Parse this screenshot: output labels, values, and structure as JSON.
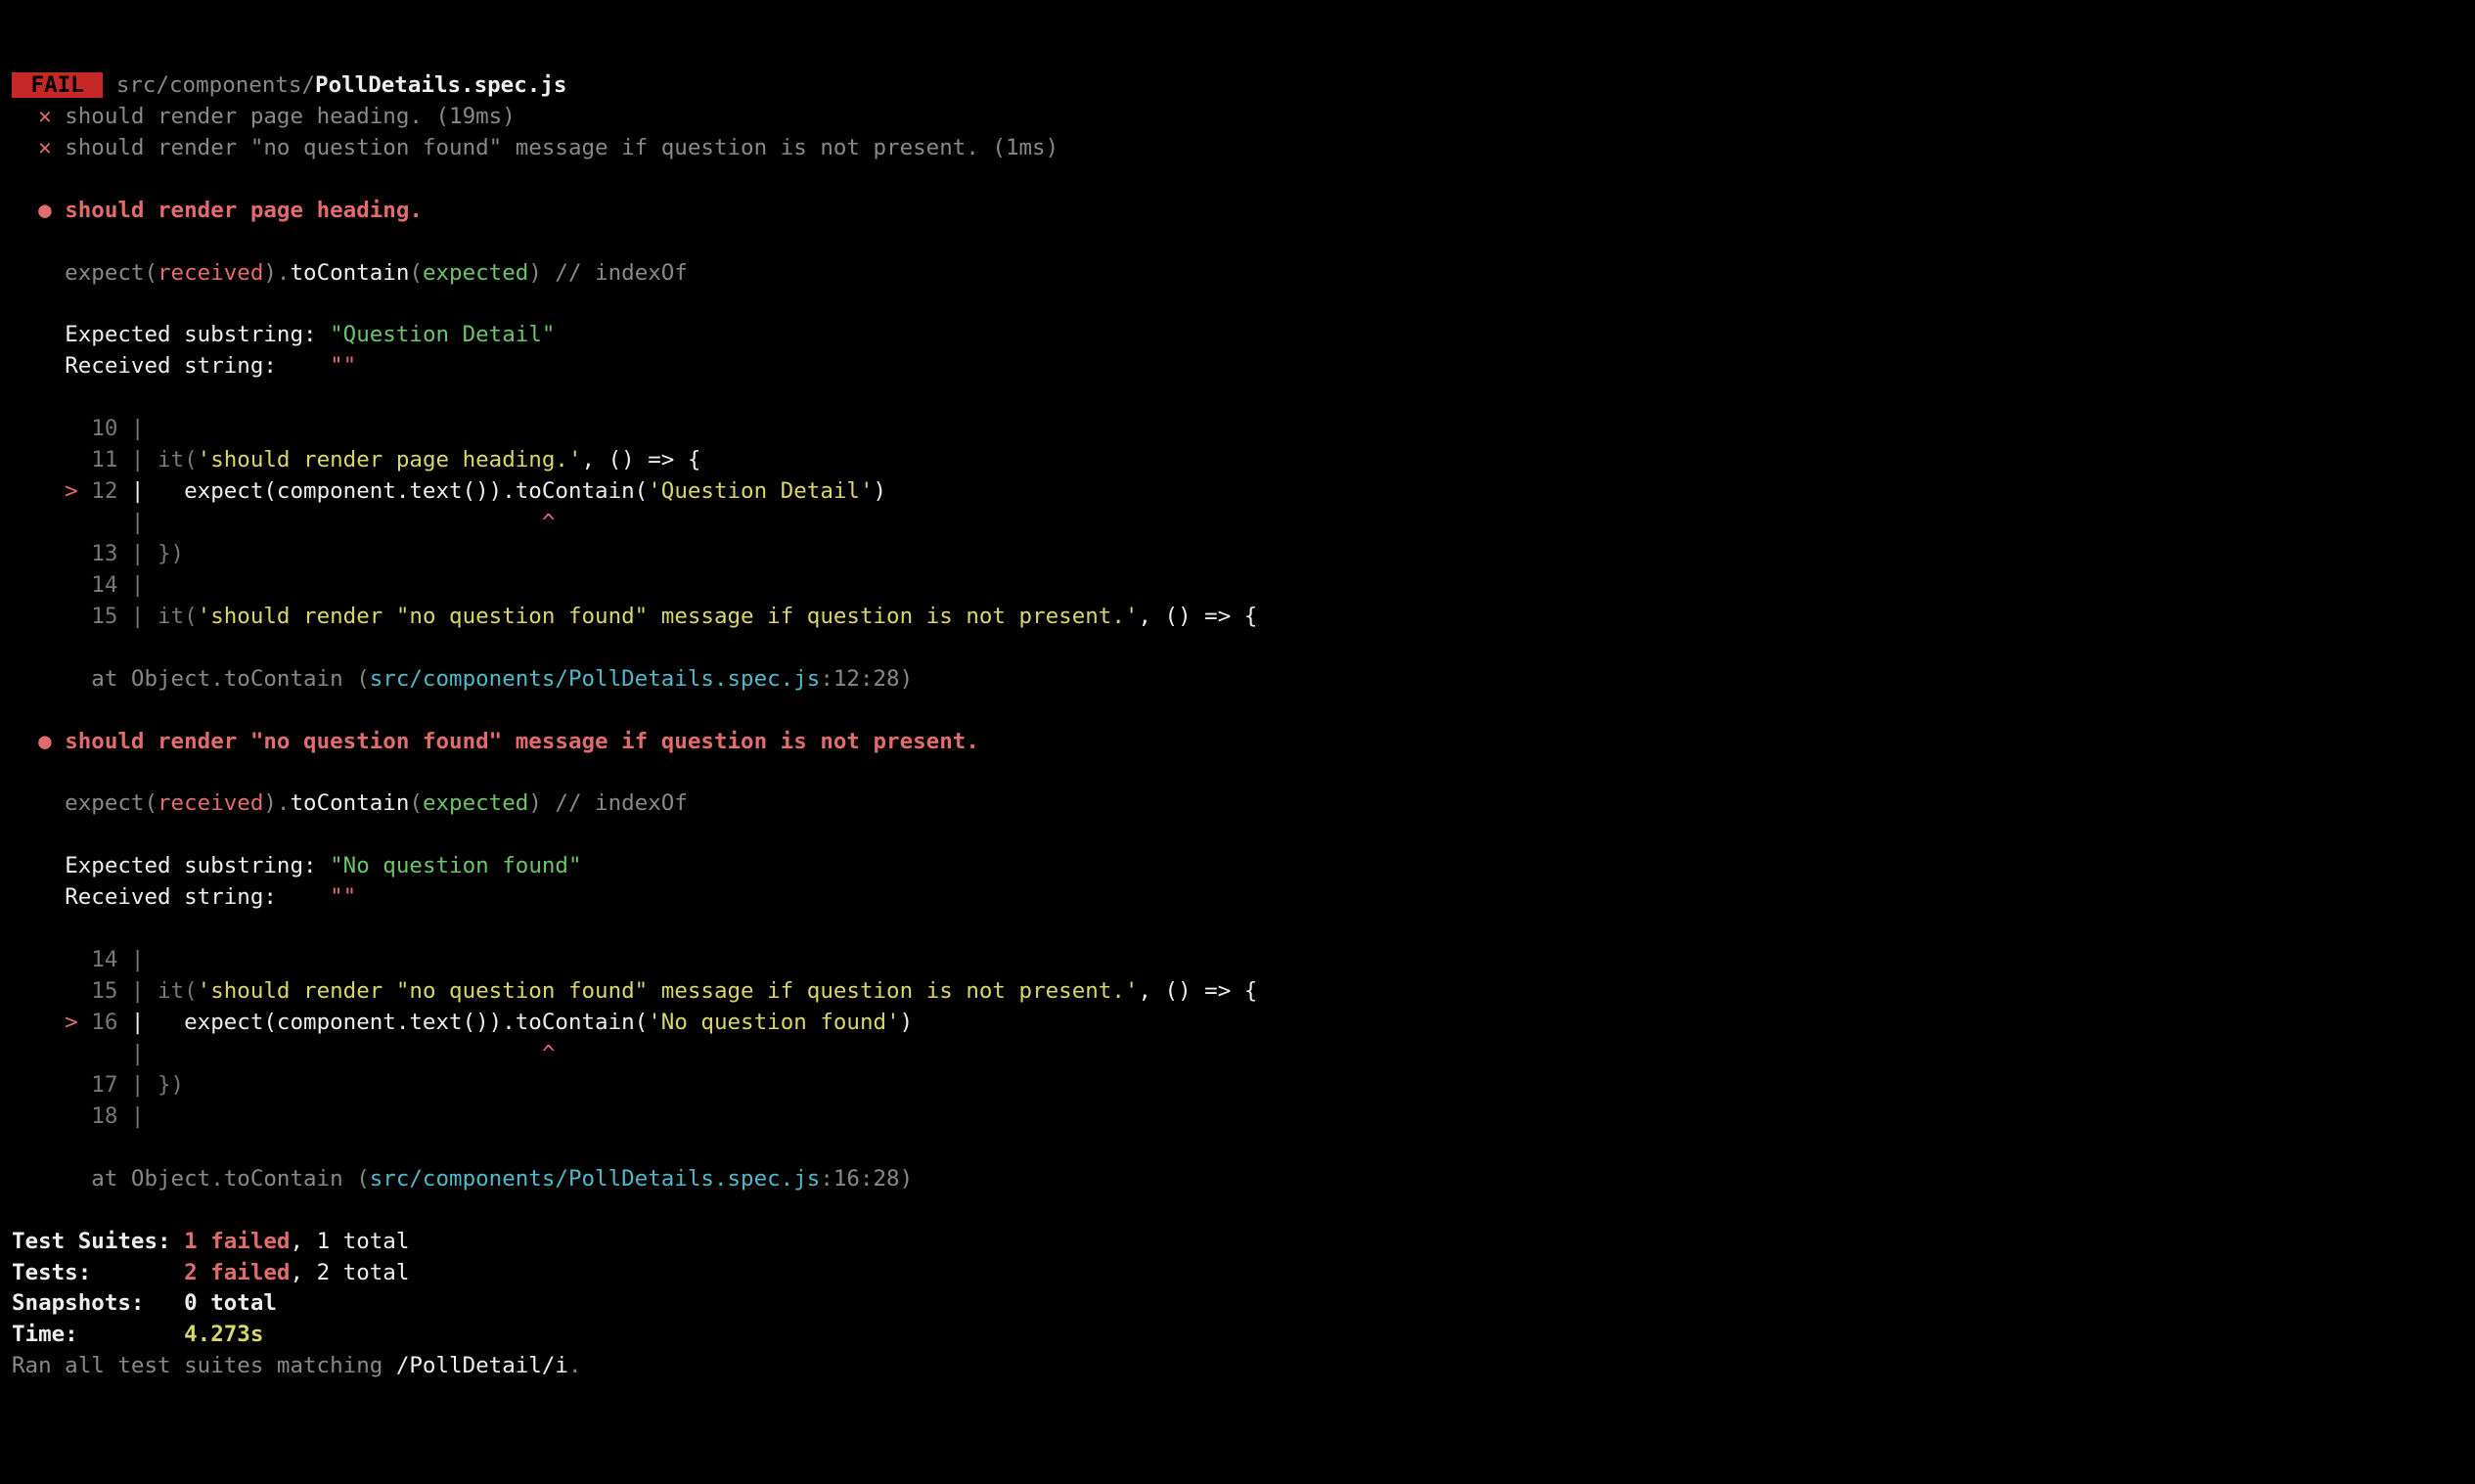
{
  "header": {
    "badge": " FAIL ",
    "path_dim": "src/components/",
    "path_file": "PollDetails.spec.js"
  },
  "run": {
    "x": "✕",
    "bullet": "●",
    "t1": "should render page heading. (19ms)",
    "t2": "should render \"no question found\" message if question is not present. (1ms)"
  },
  "block1": {
    "title": "should render page heading.",
    "exp_substr_label": "Expected substring: ",
    "exp_substr": "\"Question Detail\"",
    "recv_label": "Received string:    ",
    "recv": "\"\"",
    "code": {
      "l10": "      10 |",
      "l11a": "      11 | it(",
      "l11b": "'should render page heading.'",
      "l11c": ", () => {",
      "l12pre": "    > ",
      "l12ln": "12",
      "l12a": " |   expect(component.text()).toContain(",
      "l12b": "'Question Detail'",
      "l12c": ")",
      "caret": "         |                              ",
      "caret_sym": "^",
      "l13": "      13 | })",
      "l14": "      14 |",
      "l15a": "      15 | it(",
      "l15b": "'should render \"no question found\" message if question is not present.'",
      "l15c": ", () => {"
    },
    "stack_prefix": "      at Object.toContain (",
    "stack_file": "src/components/PollDetails.spec.js",
    "stack_loc": ":12:28)"
  },
  "block2": {
    "title": "should render \"no question found\" message if question is not present.",
    "exp_substr_label": "Expected substring: ",
    "exp_substr": "\"No question found\"",
    "recv_label": "Received string:    ",
    "recv": "\"\"",
    "code": {
      "l14": "      14 |",
      "l15a": "      15 | it(",
      "l15b": "'should render \"no question found\" message if question is not present.'",
      "l15c": ", () => {",
      "l16pre": "    > ",
      "l16ln": "16",
      "l16a": " |   expect(component.text()).toContain(",
      "l16b": "'No question found'",
      "l16c": ")",
      "caret": "         |                              ",
      "caret_sym": "^",
      "l17": "      17 | })",
      "l18": "      18 |"
    },
    "stack_prefix": "      at Object.toContain (",
    "stack_file": "src/components/PollDetails.spec.js",
    "stack_loc": ":16:28)"
  },
  "assert": {
    "p1": "    expect(",
    "recv": "received",
    "p2": ").",
    "fn": "toContain",
    "p3": "(",
    "exp": "expected",
    "p4": ") ",
    "comment": "// indexOf"
  },
  "summary": {
    "ts_label": "Test Suites: ",
    "ts_fail": "1 failed",
    "ts_rest": ", 1 total",
    "t_label": "Tests:       ",
    "t_fail": "2 failed",
    "t_rest": ", 2 total",
    "snap": "Snapshots:   0 total",
    "time_lbl": "Time:        ",
    "time_val": "4.273s",
    "ran_pre": "Ran all test suites matching ",
    "ran_pat": "/PollDetail/i",
    "ran_post": "."
  }
}
